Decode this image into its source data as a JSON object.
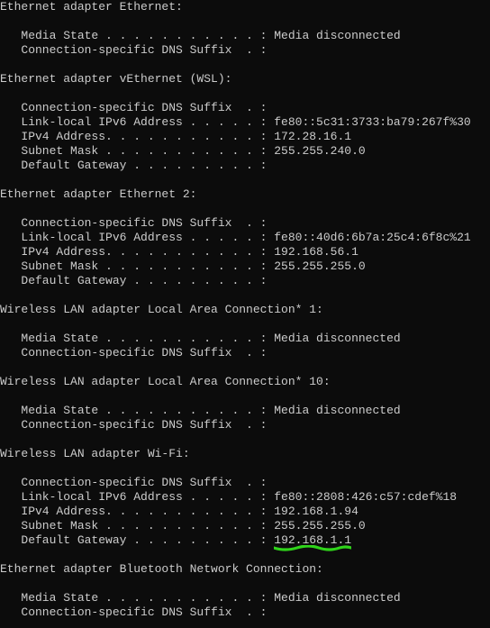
{
  "sections": [
    {
      "header": "Ethernet adapter Ethernet:",
      "lines": [
        {
          "label": "   Media State . . . . . . . . . . . :",
          "value": " Media disconnected"
        },
        {
          "label": "   Connection-specific DNS Suffix  . :",
          "value": ""
        }
      ]
    },
    {
      "header": "Ethernet adapter vEthernet (WSL):",
      "lines": [
        {
          "label": "   Connection-specific DNS Suffix  . :",
          "value": ""
        },
        {
          "label": "   Link-local IPv6 Address . . . . . :",
          "value": " fe80::5c31:3733:ba79:267f%30"
        },
        {
          "label": "   IPv4 Address. . . . . . . . . . . :",
          "value": " 172.28.16.1"
        },
        {
          "label": "   Subnet Mask . . . . . . . . . . . :",
          "value": " 255.255.240.0"
        },
        {
          "label": "   Default Gateway . . . . . . . . . :",
          "value": ""
        }
      ]
    },
    {
      "header": "Ethernet adapter Ethernet 2:",
      "lines": [
        {
          "label": "   Connection-specific DNS Suffix  . :",
          "value": ""
        },
        {
          "label": "   Link-local IPv6 Address . . . . . :",
          "value": " fe80::40d6:6b7a:25c4:6f8c%21"
        },
        {
          "label": "   IPv4 Address. . . . . . . . . . . :",
          "value": " 192.168.56.1"
        },
        {
          "label": "   Subnet Mask . . . . . . . . . . . :",
          "value": " 255.255.255.0"
        },
        {
          "label": "   Default Gateway . . . . . . . . . :",
          "value": ""
        }
      ]
    },
    {
      "header": "Wireless LAN adapter Local Area Connection* 1:",
      "lines": [
        {
          "label": "   Media State . . . . . . . . . . . :",
          "value": " Media disconnected"
        },
        {
          "label": "   Connection-specific DNS Suffix  . :",
          "value": ""
        }
      ]
    },
    {
      "header": "Wireless LAN adapter Local Area Connection* 10:",
      "lines": [
        {
          "label": "   Media State . . . . . . . . . . . :",
          "value": " Media disconnected"
        },
        {
          "label": "   Connection-specific DNS Suffix  . :",
          "value": ""
        }
      ]
    },
    {
      "header": "Wireless LAN adapter Wi-Fi:",
      "lines": [
        {
          "label": "   Connection-specific DNS Suffix  . :",
          "value": ""
        },
        {
          "label": "   Link-local IPv6 Address . . . . . :",
          "value": " fe80::2808:426:c57:cdef%18"
        },
        {
          "label": "   IPv4 Address. . . . . . . . . . . :",
          "value": " 192.168.1.94"
        },
        {
          "label": "   Subnet Mask . . . . . . . . . . . :",
          "value": " 255.255.255.0"
        },
        {
          "label": "   Default Gateway . . . . . . . . . :",
          "value": " ",
          "highlight_value": "192.168.1.1"
        }
      ]
    },
    {
      "header": "Ethernet adapter Bluetooth Network Connection:",
      "lines": [
        {
          "label": "   Media State . . . . . . . . . . . :",
          "value": " Media disconnected"
        },
        {
          "label": "   Connection-specific DNS Suffix  . :",
          "value": ""
        }
      ]
    }
  ],
  "highlight_color": "#2fd31a"
}
